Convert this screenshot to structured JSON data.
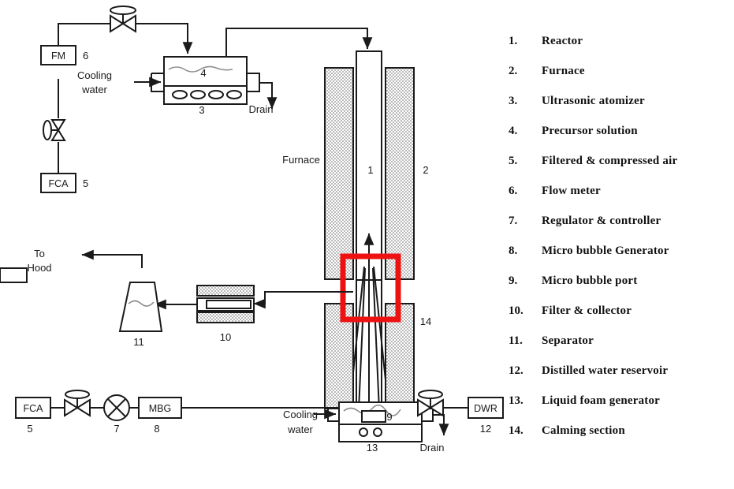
{
  "legend": {
    "items": [
      {
        "num": "1.",
        "label": "Reactor"
      },
      {
        "num": "2.",
        "label": "Furnace"
      },
      {
        "num": "3.",
        "label": "Ultrasonic atomizer"
      },
      {
        "num": "4.",
        "label": "Precursor solution"
      },
      {
        "num": "5.",
        "label": "Filtered & compressed air"
      },
      {
        "num": "6.",
        "label": "Flow meter"
      },
      {
        "num": "7.",
        "label": "Regulator & controller"
      },
      {
        "num": "8.",
        "label": "Micro bubble  Generator"
      },
      {
        "num": "9.",
        "label": "Micro bubble port"
      },
      {
        "num": "10.",
        "label": "Filter & collector"
      },
      {
        "num": "11.",
        "label": "Separator"
      },
      {
        "num": "12.",
        "label": "Distilled water reservoir"
      },
      {
        "num": "13.",
        "label": "Liquid foam generator"
      },
      {
        "num": "14.",
        "label": "Calming section"
      }
    ]
  },
  "diagram": {
    "equipment_tags": {
      "fm": "FM",
      "fca_top": "FCA",
      "fca_bottom": "FCA",
      "mbg": "MBG",
      "dwr": "DWR"
    },
    "callouts": {
      "n1": "1",
      "n2": "2",
      "n3": "3",
      "n4": "4",
      "n5_top": "5",
      "n5_bottom": "5",
      "n6": "6",
      "n7": "7",
      "n8": "8",
      "n9": "9",
      "n10": "10",
      "n11": "11",
      "n12": "12",
      "n13": "13",
      "n14": "14"
    },
    "labels": {
      "cooling_water_top_line1": "Cooling",
      "cooling_water_top_line2": "water",
      "cooling_water_bottom_line1": "Cooling",
      "cooling_water_bottom_line2": "water",
      "drain_top": "Drain",
      "drain_bottom": "Drain",
      "to_hood_line1": "To",
      "to_hood_line2": "Hood",
      "furnace": "Furnace"
    },
    "colors": {
      "line": "#1a1a1a",
      "highlight": "#ee1111",
      "hatch_fill": "#d9d9d9",
      "background": "#ffffff"
    }
  }
}
